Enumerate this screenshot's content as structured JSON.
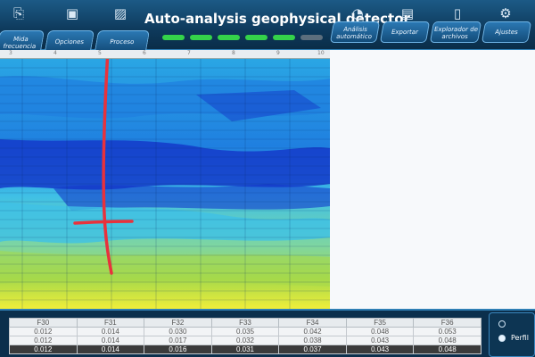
{
  "window": {
    "title": "Auto-analysis geophysical detector"
  },
  "left_tabs": [
    {
      "label": "Mida frecuencia"
    },
    {
      "label": "Opciones"
    },
    {
      "label": "Proceso"
    }
  ],
  "right_tabs": [
    {
      "label": "Análisis automático"
    },
    {
      "label": "Exportar"
    },
    {
      "label": "Explorador de archivos"
    },
    {
      "label": "Ajustes"
    }
  ],
  "toolbar_icons": [
    {
      "name": "new-file-icon"
    },
    {
      "name": "save-icon"
    },
    {
      "name": "image-icon"
    },
    {
      "name": "chart-icon"
    },
    {
      "name": "export-icon"
    },
    {
      "name": "tablet-icon"
    },
    {
      "name": "settings-icon"
    }
  ],
  "progress": {
    "segments_on": 5,
    "segments_total": 6
  },
  "ruler_ticks": [
    "3",
    "4",
    "5",
    "6",
    "7",
    "8",
    "9",
    "10"
  ],
  "colors": {
    "deep": "#1439c9",
    "mid": "#1f7fe0",
    "light": "#3fc0e6",
    "green": "#a6d94a",
    "yellow": "#f0ee3a",
    "marker": "#e8323c"
  },
  "table": {
    "headers": [
      "F30",
      "F31",
      "F32",
      "F33",
      "F34",
      "F35",
      "F36"
    ],
    "rows": [
      [
        "0.012",
        "0.014",
        "0.030",
        "0.035",
        "0.042",
        "0.048",
        "0.053"
      ],
      [
        "0.012",
        "0.014",
        "0.017",
        "0.032",
        "0.038",
        "0.043",
        "0.048"
      ],
      [
        "0.012",
        "0.014",
        "0.016",
        "0.031",
        "0.037",
        "0.043",
        "0.048"
      ]
    ],
    "selected_row": 2
  },
  "side_panel": {
    "option_label": "Perfil"
  }
}
